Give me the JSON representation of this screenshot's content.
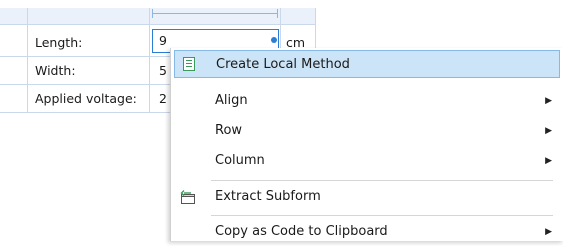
{
  "form": {
    "rows": [
      {
        "label": "Length:",
        "value": "9",
        "unit": "cm"
      },
      {
        "label": "Width:",
        "value": "5",
        "unit": ""
      },
      {
        "label": "Applied voltage:",
        "value": "2",
        "unit": ""
      }
    ]
  },
  "menu": {
    "items": [
      {
        "label": "Create Local Method",
        "icon": "method-icon",
        "submenu": false,
        "highlighted": true
      },
      {
        "label": "Align",
        "submenu": true
      },
      {
        "label": "Row",
        "submenu": true
      },
      {
        "label": "Column",
        "submenu": true
      },
      {
        "label": "Extract Subform",
        "icon": "extract-subform-icon",
        "submenu": false
      },
      {
        "label": "Copy as Code to Clipboard",
        "submenu": true
      }
    ],
    "submenu_glyph": "▶"
  },
  "colors": {
    "accent": "#2a7fd4",
    "highlight": "#cce4f7",
    "grid": "#c9d8ea",
    "icon_green": "#3a9a5b"
  }
}
